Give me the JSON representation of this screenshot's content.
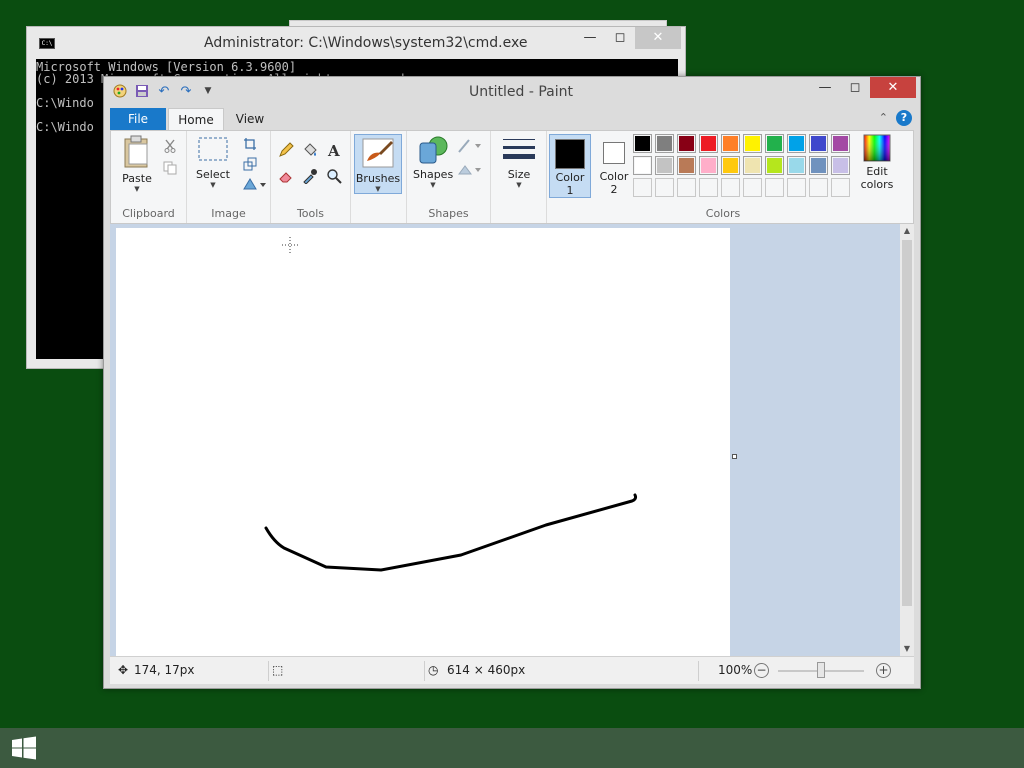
{
  "cmd": {
    "title": "Administrator: C:\\Windows\\system32\\cmd.exe",
    "icon_text": "C:\\",
    "lines": [
      "Microsoft Windows [Version 6.3.9600]",
      "(c) 2013 Microsoft Corporation. All rights reserved.",
      "",
      "C:\\Windo",
      "",
      "C:\\Windo"
    ]
  },
  "paint": {
    "title": "Untitled - Paint",
    "tabs": {
      "file": "File",
      "home": "Home",
      "view": "View"
    },
    "help": "?",
    "groups": {
      "clipboard": {
        "label": "Clipboard",
        "paste": "Paste"
      },
      "image": {
        "label": "Image",
        "select": "Select"
      },
      "tools": {
        "label": "Tools"
      },
      "brushes": {
        "label": "Brushes"
      },
      "shapes": {
        "label": "Shapes",
        "shapes_btn": "Shapes"
      },
      "size": {
        "label": "Size"
      },
      "colors": {
        "label": "Colors",
        "color1_line1": "Color",
        "color1_line2": "1",
        "color2_line1": "Color",
        "color2_line2": "2",
        "edit_line1": "Edit",
        "edit_line2": "colors",
        "color1_value": "#000000",
        "color2_value": "#ffffff",
        "palette_row1": [
          "#000000",
          "#7f7f7f",
          "#880015",
          "#ed1c24",
          "#ff7f27",
          "#fff200",
          "#22b14c",
          "#00a2e8",
          "#3f48cc",
          "#a349a4"
        ],
        "palette_row2": [
          "#ffffff",
          "#c3c3c3",
          "#b97a57",
          "#ffaec9",
          "#ffc90e",
          "#efe4b0",
          "#b5e61d",
          "#99d9ea",
          "#7092be",
          "#c8bfe7"
        ]
      }
    },
    "status": {
      "cursor_pos": "174, 17px",
      "canvas_size": "614 × 460px",
      "zoom": "100%",
      "zoom_fraction": 0.5
    }
  },
  "colors": {
    "desktop": "#0a4d10",
    "taskbar": "#3c5a40",
    "accent": "#1979ca",
    "close": "#c7423e"
  }
}
